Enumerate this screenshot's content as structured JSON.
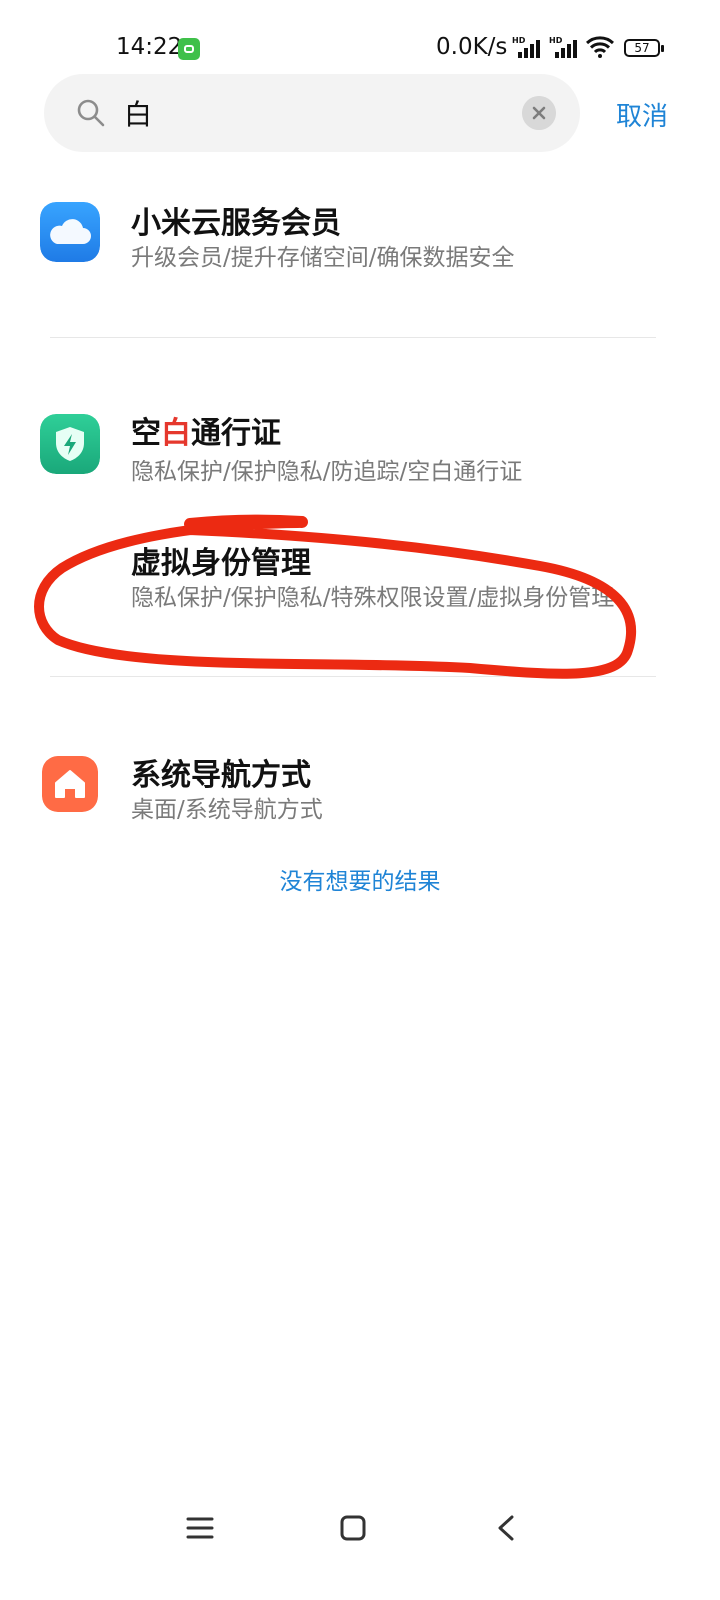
{
  "status_bar": {
    "time": "14:22",
    "net_speed": "0.0K/s",
    "signal_1_label": "HD",
    "signal_2_label": "HD",
    "battery": "57",
    "notify_icon": "android-robot-icon"
  },
  "search": {
    "query": "白",
    "placeholder": "",
    "cancel_label": "取消"
  },
  "results": [
    {
      "title": "小米云服务会员",
      "subtitle": "升级会员/提升存储空间/确保数据安全",
      "icon": "cloud-icon",
      "icon_color": "#2b8ff5"
    },
    {
      "title_pre": "空",
      "title_hl": "白",
      "title_post": "通行证",
      "subtitle": "隐私保护/保护隐私/防追踪/空白通行证",
      "icon": "shield-lightning-icon",
      "icon_color": "#22b98a",
      "highlight_color": "#e5382d"
    },
    {
      "title": "虚拟身份管理",
      "subtitle": "隐私保护/保护隐私/特殊权限设置/虚拟身份管理"
    },
    {
      "title": "系统导航方式",
      "subtitle": "桌面/系统导航方式",
      "icon": "home-icon",
      "icon_color": "#ff6b45"
    }
  ],
  "no_result_link": "没有想要的结果",
  "colors": {
    "accent": "#1f84d6",
    "annotation": "#ec2a12"
  },
  "nav_bar": {
    "menu_icon": "menu-icon",
    "home_icon": "square-home-icon",
    "back_icon": "back-chevron-icon"
  }
}
